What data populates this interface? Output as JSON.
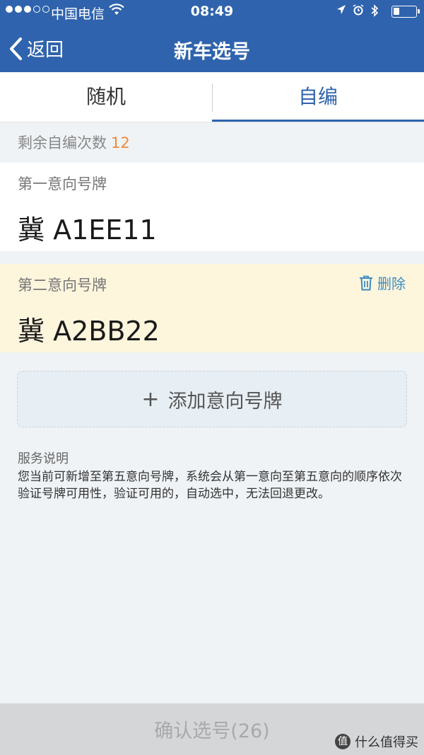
{
  "status_bar": {
    "carrier": "中国电信",
    "time": "08:49",
    "icons": [
      "signal-dots",
      "wifi-icon",
      "location-arrow-icon",
      "alarm-icon",
      "bluetooth-icon",
      "battery-icon"
    ]
  },
  "navbar": {
    "back_label": "返回",
    "title": "新车选号"
  },
  "tabs": [
    {
      "label": "随机",
      "active": false
    },
    {
      "label": "自编",
      "active": true
    }
  ],
  "remaining": {
    "label": "剩余自编次数",
    "count": "12"
  },
  "plates": [
    {
      "label": "第一意向号牌",
      "value": "冀 A1EE11",
      "highlighted": false
    },
    {
      "label": "第二意向号牌",
      "value": "冀 A2BB22",
      "highlighted": true,
      "delete_label": "删除"
    }
  ],
  "add_plate": {
    "plus": "+",
    "label": "添加意向号牌"
  },
  "service": {
    "title": "服务说明",
    "text": "您当前可新增至第五意向号牌，系统会从第一意向至第五意向的顺序依次验证号牌可用性，验证可用的，自动选中，无法回退更改。"
  },
  "confirm_button": "确认选号(26)",
  "watermark": {
    "logo": "值",
    "text": "什么值得买"
  },
  "colors": {
    "brand": "#2f63ad",
    "highlight_bg": "#fdf5dc",
    "count_orange": "#ef8a3c",
    "delete_blue": "#3b8dc2"
  }
}
